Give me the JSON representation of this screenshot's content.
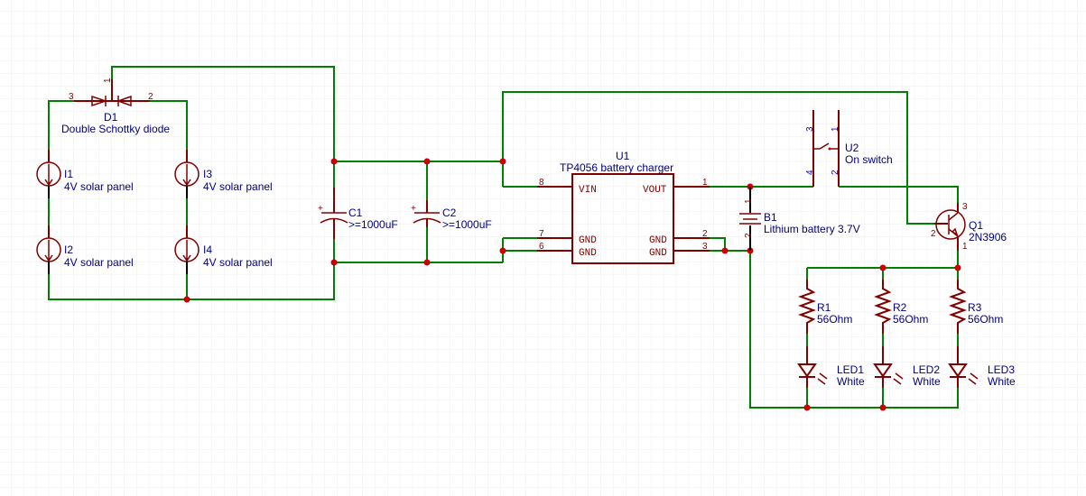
{
  "colors": {
    "wire": "#008000",
    "symbol": "#800000",
    "junction": "#cc0000",
    "label": "#000080",
    "grid": "#ececec"
  },
  "d1": {
    "ref": "D1",
    "value": "Double Schottky diode",
    "pins": [
      "1",
      "2",
      "3"
    ]
  },
  "i1": {
    "ref": "I1",
    "value": "4V solar panel"
  },
  "i2": {
    "ref": "I2",
    "value": "4V solar panel"
  },
  "i3": {
    "ref": "I3",
    "value": "4V solar panel"
  },
  "i4": {
    "ref": "I4",
    "value": "4V solar panel"
  },
  "c1": {
    "ref": "C1",
    "value": ">=1000uF",
    "polarity": "+"
  },
  "c2": {
    "ref": "C2",
    "value": ">=1000uF",
    "polarity": "+"
  },
  "u1": {
    "ref": "U1",
    "value": "TP4056 battery charger",
    "pins": {
      "vin": "VIN",
      "vout": "VOUT",
      "gnd": "GND",
      "p1": "1",
      "p2": "2",
      "p3": "3",
      "p6": "6",
      "p7": "7",
      "p8": "8"
    }
  },
  "b1": {
    "ref": "B1",
    "value": "Lithium battery 3.7V",
    "pins": [
      "1",
      "2"
    ]
  },
  "u2": {
    "ref": "U2",
    "value": "On switch",
    "pins": [
      "1",
      "2",
      "3",
      "4"
    ]
  },
  "q1": {
    "ref": "Q1",
    "value": "2N3906",
    "pins": [
      "1",
      "2",
      "3"
    ]
  },
  "r1": {
    "ref": "R1",
    "value": "56Ohm"
  },
  "r2": {
    "ref": "R2",
    "value": "56Ohm"
  },
  "r3": {
    "ref": "R3",
    "value": "56Ohm"
  },
  "led1": {
    "ref": "LED1",
    "value": "White"
  },
  "led2": {
    "ref": "LED2",
    "value": "White"
  },
  "led3": {
    "ref": "LED3",
    "value": "White"
  }
}
